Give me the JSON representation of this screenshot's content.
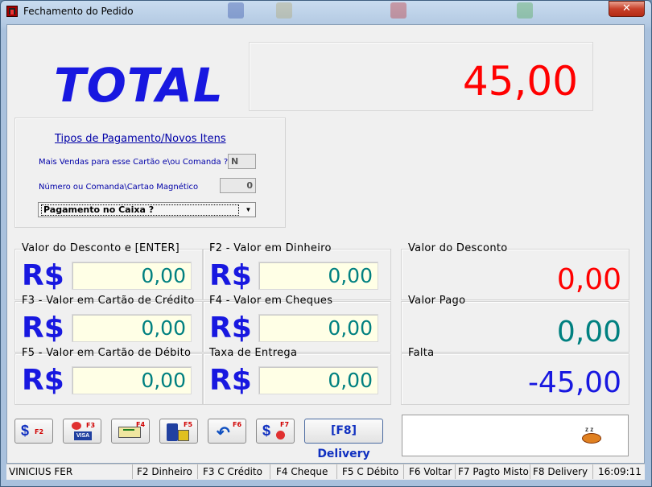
{
  "window": {
    "title": "Fechamento do Pedido",
    "close_label": "✕"
  },
  "total": {
    "label": "TOTAL",
    "value": "45,00"
  },
  "payment_types": {
    "title": "Tipos de Pagamento/Novos Itens",
    "more_sales_label": "Mais Vendas para esse Cartão e\\ou Comanda ?",
    "more_sales_value": "N",
    "number_label": "Número ou Comanda\\Cartao Magnético",
    "number_value": "0",
    "combo_value": "Pagamento no Caixa ?"
  },
  "fields": {
    "currency": "R$",
    "discount": {
      "label": "Valor do Desconto e [ENTER]",
      "value": "0,00"
    },
    "cash": {
      "label": "F2 - Valor em Dinheiro",
      "value": "0,00"
    },
    "credit": {
      "label": "F3 - Valor em Cartão de Crédito",
      "value": "0,00"
    },
    "cheque": {
      "label": "F4 - Valor em Cheques",
      "value": "0,00"
    },
    "debit": {
      "label": "F5 - Valor em Cartão de Débito",
      "value": "0,00"
    },
    "delivery_fee": {
      "label": "Taxa de Entrega",
      "value": "0,00"
    }
  },
  "summary": {
    "discount": {
      "label": "Valor do Desconto",
      "value": "0,00",
      "color": "#ff0000"
    },
    "paid": {
      "label": "Valor Pago",
      "value": "0,00",
      "color": "#008080"
    },
    "missing": {
      "label": "Falta",
      "value": "-45,00",
      "color": "#1818e0"
    }
  },
  "buttons": {
    "f2": "F2",
    "f3": "F3",
    "f4": "F4",
    "f5": "F5",
    "f6": "F6",
    "f7": "F7",
    "visa": "VISA",
    "delivery": "[F8] Delivery"
  },
  "statusbar": {
    "user": "VINICIUS FER",
    "f2": "F2 Dinheiro",
    "f3": "F3 C Crédito",
    "f4": "F4 Cheque",
    "f5": "F5 C Débito",
    "f6": "F6 Voltar",
    "f7": "F7 Pagto Misto",
    "f8": "F8 Delivery",
    "time": "16:09:11"
  },
  "colors": {
    "accent_blue": "#1818e0",
    "total_red": "#ff0000",
    "teal": "#008080",
    "input_bg": "#ffffe6"
  }
}
